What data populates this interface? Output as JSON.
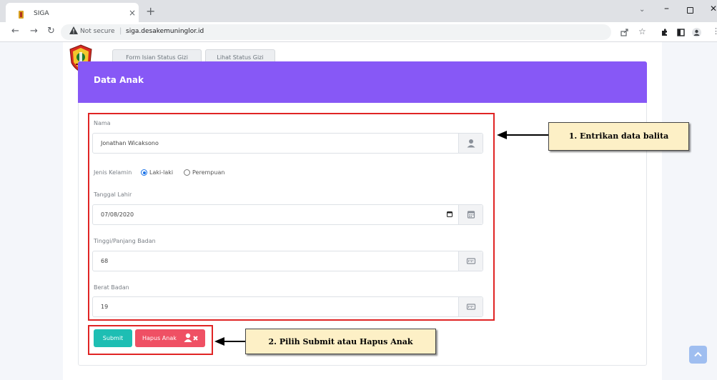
{
  "browser": {
    "tab_title": "SIGA",
    "tab_close": "×",
    "new_tab": "+",
    "not_secure": "Not secure",
    "url": "siga.desakemuninglor.id",
    "icons": [
      "share-icon",
      "star-icon",
      "extensions-icon",
      "sidebar-icon",
      "profile-icon",
      "menu-icon"
    ]
  },
  "nav_tabs": [
    {
      "label": "Form Isian Status Gizi"
    },
    {
      "label": "Lihat Status Gizi"
    }
  ],
  "card": {
    "title": "Data Anak"
  },
  "form": {
    "nama": {
      "label": "Nama",
      "value": "Jonathan Wicaksono"
    },
    "jenis_kelamin": {
      "label": "Jenis Kelamin",
      "options": [
        "Laki-laki",
        "Perempuan"
      ],
      "selected": "Laki-laki"
    },
    "tanggal_lahir": {
      "label": "Tanggal Lahir",
      "value": "07/08/2020"
    },
    "tinggi": {
      "label": "Tinggi/Panjang Badan",
      "value": "68"
    },
    "berat": {
      "label": "Berat Badan",
      "value": "19"
    }
  },
  "buttons": {
    "submit": "Submit",
    "hapus": "Hapus Anak"
  },
  "annotations": {
    "step1": "1. Entrikan data balita",
    "step2": "2. Pilih Submit atau Hapus Anak"
  },
  "colors": {
    "header": "#8758f6",
    "submit": "#1ebeb3",
    "hapus": "#ef5064",
    "highlight": "#e02424",
    "callout_bg": "#fdf0c6"
  }
}
